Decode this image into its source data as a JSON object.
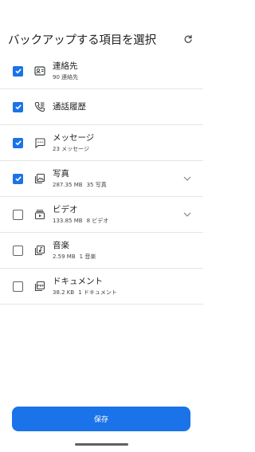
{
  "header": {
    "title": "バックアップする項目を選択",
    "refresh_icon": "refresh-icon"
  },
  "items": [
    {
      "name": "連絡先",
      "sub": [
        "90 連絡先"
      ],
      "checked": true,
      "icon": "contacts-icon",
      "expandable": false
    },
    {
      "name": "通話履歴",
      "sub": [],
      "checked": true,
      "icon": "call-log-icon",
      "expandable": false
    },
    {
      "name": "メッセージ",
      "sub": [
        "23 メッセージ"
      ],
      "checked": true,
      "icon": "message-icon",
      "expandable": false
    },
    {
      "name": "写真",
      "sub": [
        "287.35 MB",
        "35 写真"
      ],
      "checked": true,
      "icon": "photos-icon",
      "expandable": true
    },
    {
      "name": "ビデオ",
      "sub": [
        "133.85 MB",
        "8 ビデオ"
      ],
      "checked": false,
      "icon": "video-icon",
      "expandable": true
    },
    {
      "name": "音楽",
      "sub": [
        "2.59 MB",
        "1 音楽"
      ],
      "checked": false,
      "icon": "music-icon",
      "expandable": false
    },
    {
      "name": "ドキュメント",
      "sub": [
        "38.2 KB",
        "1 ドキュメント"
      ],
      "checked": false,
      "icon": "document-icon",
      "expandable": false
    }
  ],
  "footer": {
    "save_label": "保存"
  },
  "colors": {
    "accent": "#1a73e8",
    "text": "#202124",
    "divider": "#e5e5e5"
  }
}
